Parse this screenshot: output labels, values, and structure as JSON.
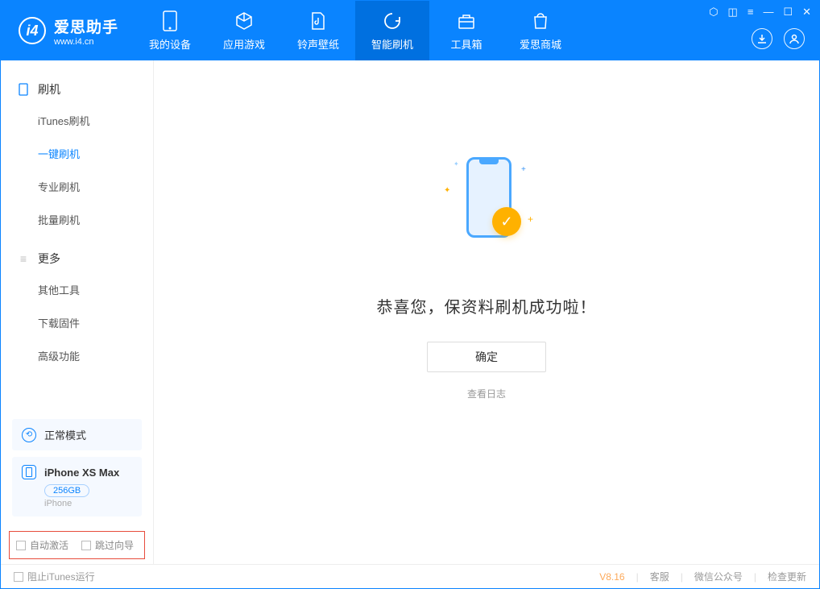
{
  "header": {
    "logo_title": "爱思助手",
    "logo_sub": "www.i4.cn",
    "nav": [
      {
        "label": "我的设备"
      },
      {
        "label": "应用游戏"
      },
      {
        "label": "铃声壁纸"
      },
      {
        "label": "智能刷机"
      },
      {
        "label": "工具箱"
      },
      {
        "label": "爱思商城"
      }
    ]
  },
  "sidebar": {
    "section1_title": "刷机",
    "section1_items": [
      "iTunes刷机",
      "一键刷机",
      "专业刷机",
      "批量刷机"
    ],
    "section2_title": "更多",
    "section2_items": [
      "其他工具",
      "下载固件",
      "高级功能"
    ],
    "mode_label": "正常模式",
    "device_name": "iPhone XS Max",
    "device_capacity": "256GB",
    "device_type": "iPhone",
    "opt_auto_activate": "自动激活",
    "opt_skip_guide": "跳过向导"
  },
  "main": {
    "success_message": "恭喜您，保资料刷机成功啦！",
    "ok_button": "确定",
    "view_log": "查看日志"
  },
  "footer": {
    "block_itunes": "阻止iTunes运行",
    "version": "V8.16",
    "service": "客服",
    "wechat": "微信公众号",
    "check_update": "检查更新"
  }
}
